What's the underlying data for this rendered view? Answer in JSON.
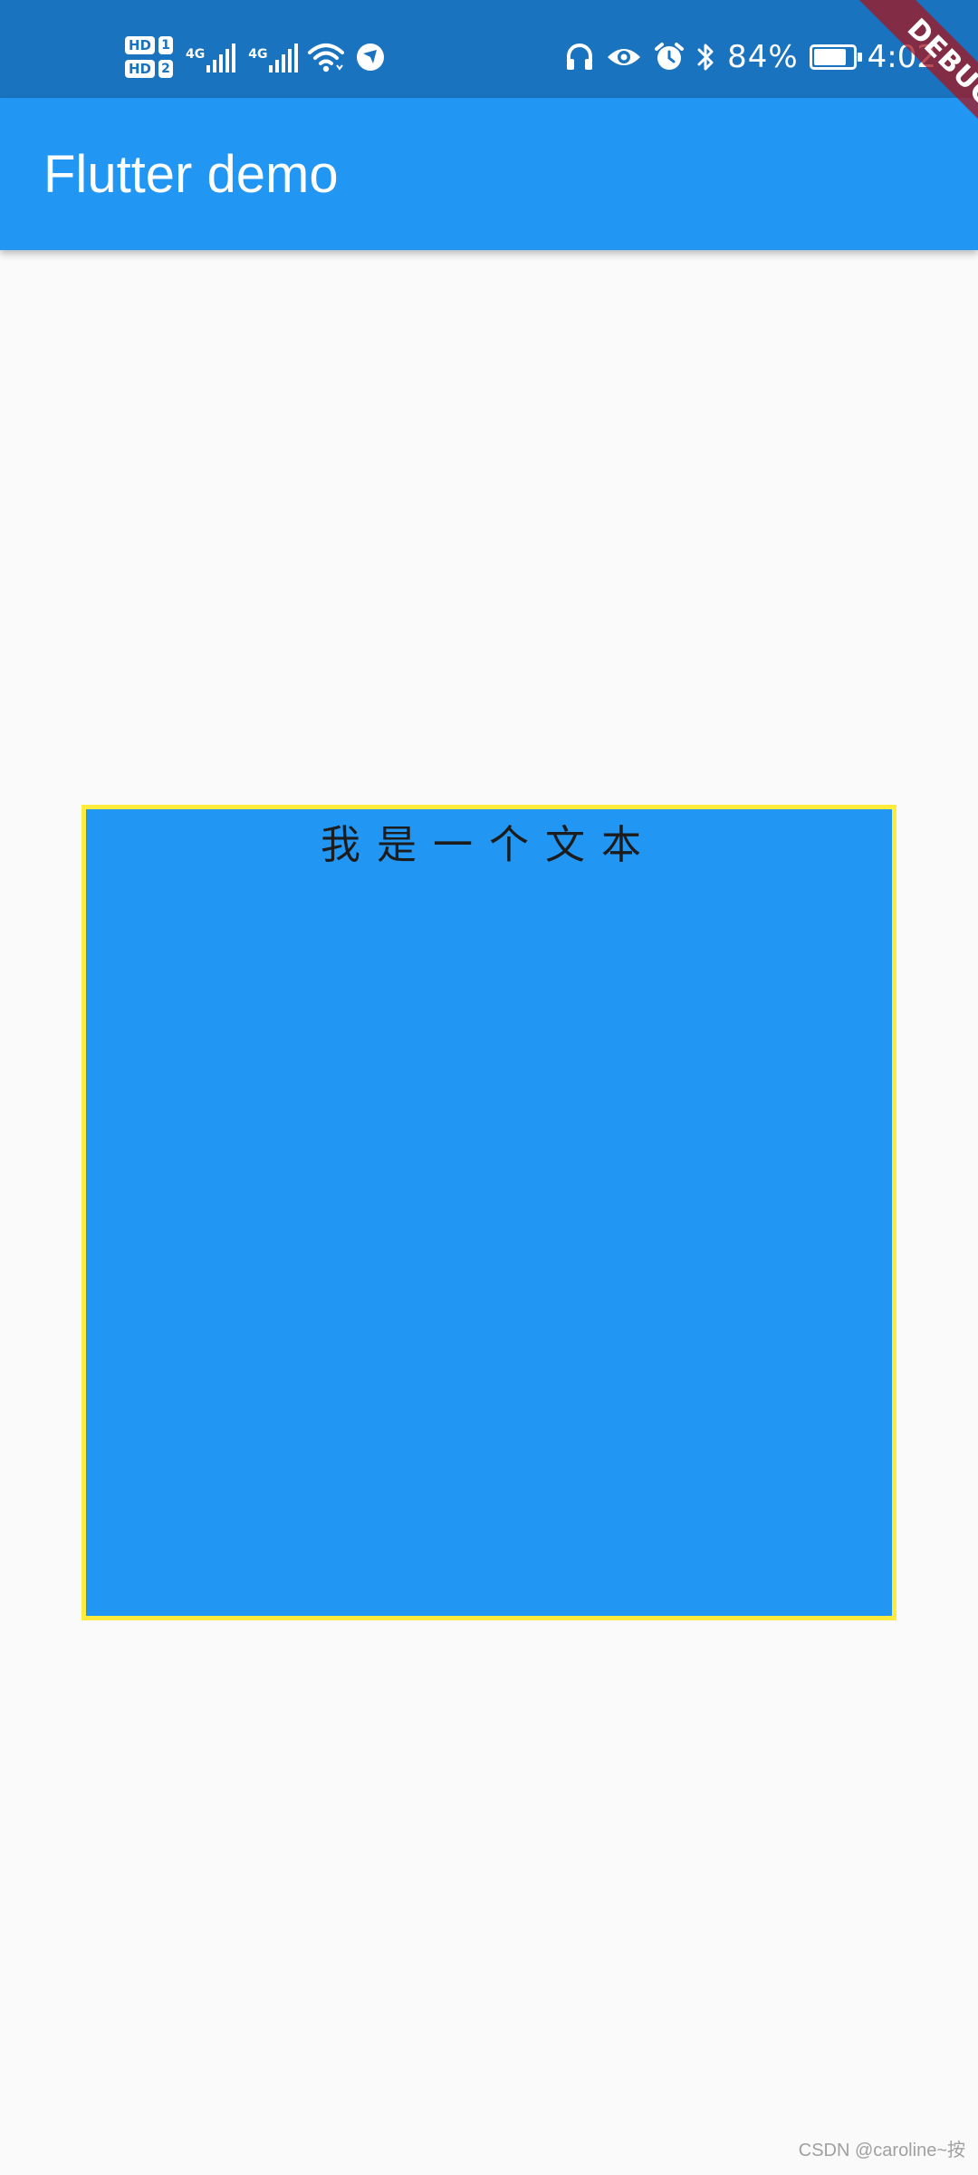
{
  "status_bar": {
    "sim1_badge": "HD",
    "sim1_slot": "1",
    "sim2_badge": "HD",
    "sim2_slot": "2",
    "network1_type": "4G",
    "network2_type": "4G",
    "icons_left": [
      "signal-icon",
      "signal-icon",
      "wifi-icon",
      "location-icon"
    ],
    "icons_right": [
      "headphones-icon",
      "eye-icon",
      "alarm-icon",
      "bluetooth-icon"
    ],
    "battery_percent": "84%",
    "battery_level": 0.84,
    "charging": true,
    "time": "4:02"
  },
  "app_bar": {
    "title": "Flutter demo",
    "background": "#2196f3"
  },
  "debug_banner": {
    "label": "DEBUG"
  },
  "body": {
    "box_text": "我是一个文本",
    "box_background": "#2196f3",
    "box_border_color": "#ffeb3b"
  },
  "watermark": {
    "text": "CSDN @caroline~按"
  }
}
